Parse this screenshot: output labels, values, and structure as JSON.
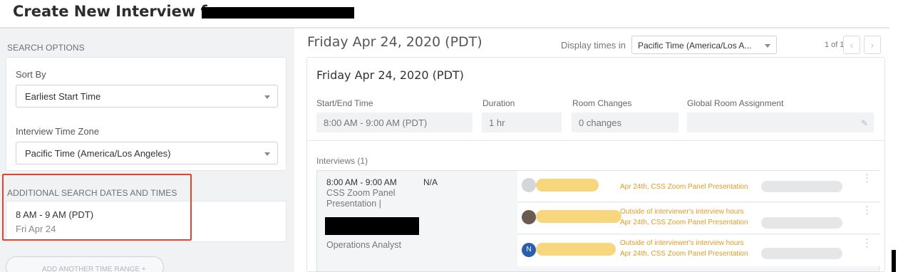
{
  "header": {
    "title": "Create New Interview for"
  },
  "left": {
    "search_options_label": "SEARCH OPTIONS",
    "sort_by_label": "Sort By",
    "sort_by_value": "Earliest Start Time",
    "timezone_label": "Interview Time Zone",
    "timezone_value": "Pacific Time (America/Los Angeles)",
    "additional_label": "ADDITIONAL SEARCH DATES AND TIMES",
    "time_range": "8 AM - 9 AM (PDT)",
    "time_date": "Fri Apr 24",
    "add_range_label": "ADD ANOTHER TIME RANGE",
    "add_range_icon": "+"
  },
  "right": {
    "date_heading": "Friday Apr 24, 2020 (PDT)",
    "display_times_label": "Display times in",
    "display_tz_value": "Pacific Time (America/Los A...",
    "pager": "1 of 1",
    "prev_icon": "‹",
    "next_icon": "›",
    "card_date": "Friday Apr 24, 2020 (PDT)",
    "columns": {
      "start_end_label": "Start/End Time",
      "start_end_value": "8:00 AM - 9:00 AM (PDT)",
      "duration_label": "Duration",
      "duration_value": "1 hr",
      "room_changes_label": "Room Changes",
      "room_changes_value": "0 changes",
      "global_room_label": "Global Room Assignment",
      "global_room_value": ""
    },
    "interviews_label": "Interviews (1)",
    "interview": {
      "time": "8:00 AM - 9:00 AM",
      "location": "N/A",
      "title": "CSS Zoom Panel Presentation |",
      "role": "Operations Analyst",
      "interviewers": [
        {
          "avatar_initial": "",
          "avatar_color": "#d4d6d9",
          "notes": [
            "Apr 24th, CSS Zoom Panel Presentation"
          ]
        },
        {
          "avatar_initial": "",
          "avatar_color": "#6b5a4f",
          "notes": [
            "Outside of interviewer's interview hours",
            "Apr 24th, CSS Zoom Panel Presentation"
          ]
        },
        {
          "avatar_initial": "N",
          "avatar_color": "#2a5fb0",
          "notes": [
            "Outside of interviewer's interview hours",
            "Apr 24th, CSS Zoom Panel Presentation"
          ]
        }
      ]
    }
  },
  "colors": {
    "highlight": "#e0452f",
    "warning_text": "#e09a26",
    "redaction_blob": "#f7d67e"
  }
}
